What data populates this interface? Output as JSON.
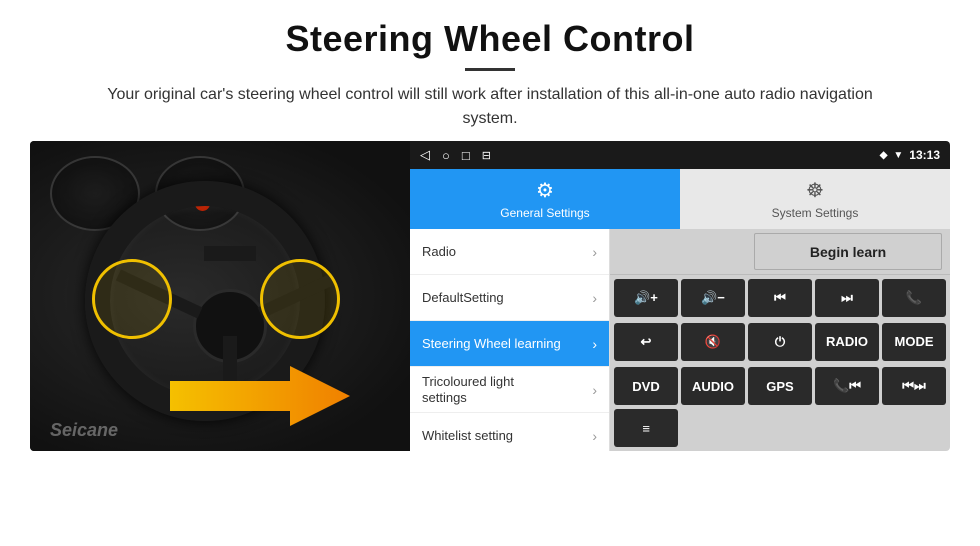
{
  "header": {
    "title": "Steering Wheel Control",
    "subtitle": "Your original car's steering wheel control will still work after installation of this all-in-one auto radio navigation system."
  },
  "status_bar": {
    "icons": [
      "◁",
      "○",
      "□",
      "⊟"
    ],
    "right_icons": "♦ ▼",
    "time": "13:13"
  },
  "tabs": {
    "general": {
      "label": "General Settings",
      "icon": "⚙"
    },
    "system": {
      "label": "System Settings",
      "icon": "☸"
    }
  },
  "settings_items": [
    {
      "label": "Radio",
      "active": false
    },
    {
      "label": "DefaultSetting",
      "active": false
    },
    {
      "label": "Steering Wheel learning",
      "active": true
    },
    {
      "label": "Tricoloured light settings",
      "active": false,
      "multiline": true,
      "label2": "settings"
    },
    {
      "label": "Whitelist setting",
      "active": false
    }
  ],
  "begin_learn_label": "Begin learn",
  "control_buttons": {
    "row1": [
      {
        "label": "🔇+",
        "icon": true
      },
      {
        "label": "🔇−",
        "icon": true
      },
      {
        "label": "⏮",
        "icon": true
      },
      {
        "label": "⏭",
        "icon": true
      },
      {
        "label": "📞",
        "icon": true
      }
    ],
    "row2": [
      {
        "label": "↩",
        "icon": true
      },
      {
        "label": "🔇×",
        "icon": true
      },
      {
        "label": "⏻",
        "icon": true
      },
      {
        "label": "RADIO",
        "icon": false
      },
      {
        "label": "MODE",
        "icon": false
      }
    ],
    "row3": [
      {
        "label": "DVD",
        "icon": false
      },
      {
        "label": "AUDIO",
        "icon": false
      },
      {
        "label": "GPS",
        "icon": false
      },
      {
        "label": "📞⏮",
        "icon": true
      },
      {
        "label": "⏮⏭",
        "icon": true
      }
    ],
    "row4_single": {
      "label": "≡",
      "icon": true
    }
  }
}
